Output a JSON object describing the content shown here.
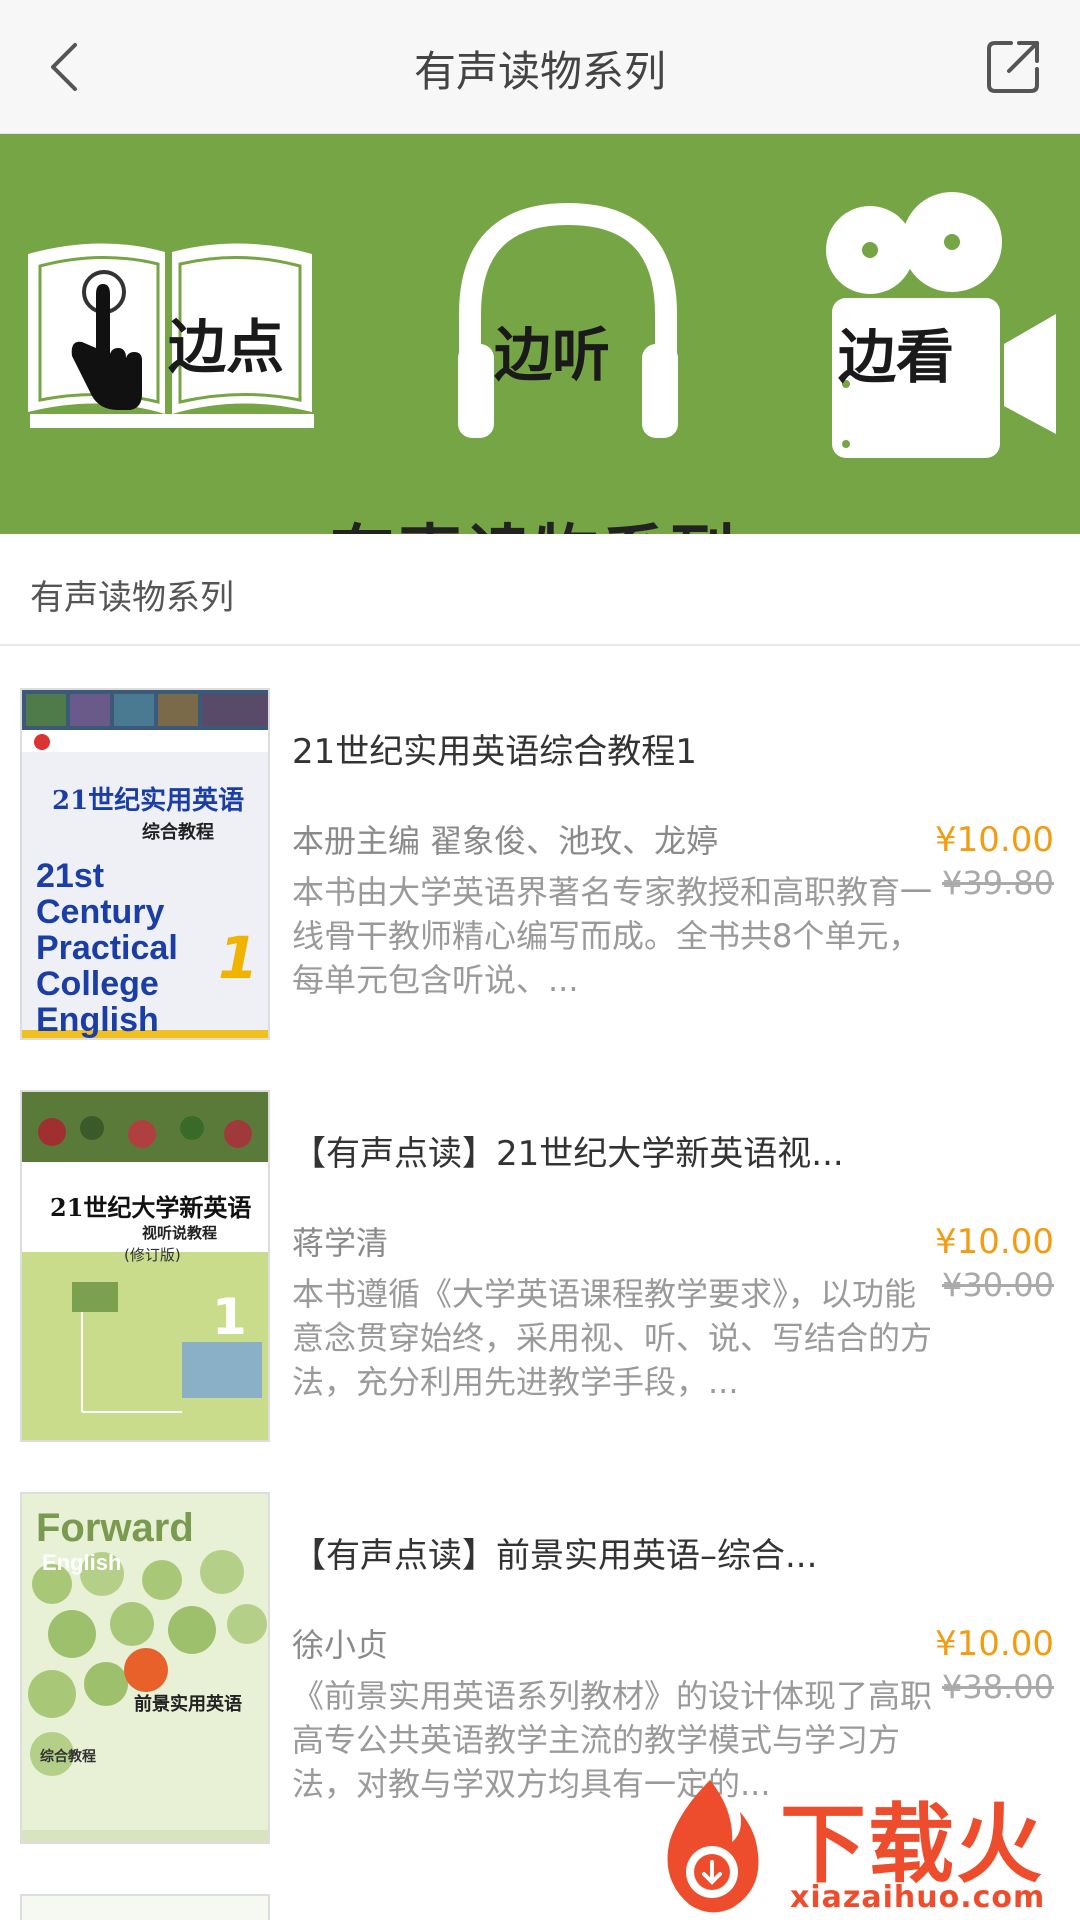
{
  "header": {
    "title": "有声读物系列",
    "back_icon": "chevron-left-icon",
    "share_icon": "share-icon"
  },
  "banner": {
    "labels": [
      "边点",
      "边听",
      "边看"
    ],
    "bottom_text": "有声读物系列",
    "background": "#76a545"
  },
  "section": {
    "title": "有声读物系列"
  },
  "books": [
    {
      "title": "21世纪实用英语综合教程1",
      "author": "本册主编 翟象俊、池玫、龙婷",
      "description": "本书由大学英语界著名专家教授和高职教育一线骨干教师精心编写而成。全书共8个单元，每单元包含听说、...",
      "price": "¥10.00",
      "original_price": "¥39.80",
      "cover": {
        "line1": "21世纪实用英语",
        "line2": "综合教程",
        "line3": "21st Century Practical College English",
        "number": "1"
      }
    },
    {
      "title": "【有声点读】21世纪大学新英语视...",
      "author": "蒋学清",
      "description": "本书遵循《大学英语课程教学要求》，以功能意念贯穿始终，采用视、听、说、写结合的方法，充分利用先进教学手段，...",
      "price": "¥10.00",
      "original_price": "¥30.00",
      "cover": {
        "line1": "21世纪大学新英语",
        "line2": "视听说教程",
        "line3": "(修订版)",
        "number": "1"
      }
    },
    {
      "title": "【有声点读】前景实用英语–综合...",
      "author": "徐小贞",
      "description": "《前景实用英语系列教材》的设计体现了高职高专公共英语教学主流的教学模式与学习方法，对教与学双方均具有一定的...",
      "price": "¥10.00",
      "original_price": "¥38.00",
      "cover": {
        "line1": "Forward",
        "line2": "English",
        "line3": "前景实用英语",
        "line4": "综合教程"
      }
    }
  ],
  "watermark": {
    "text": "下载火",
    "url": "xiazaihuo.com",
    "color": "#ee4d2d"
  },
  "colors": {
    "price": "#f39c12",
    "banner_green": "#76a545"
  }
}
